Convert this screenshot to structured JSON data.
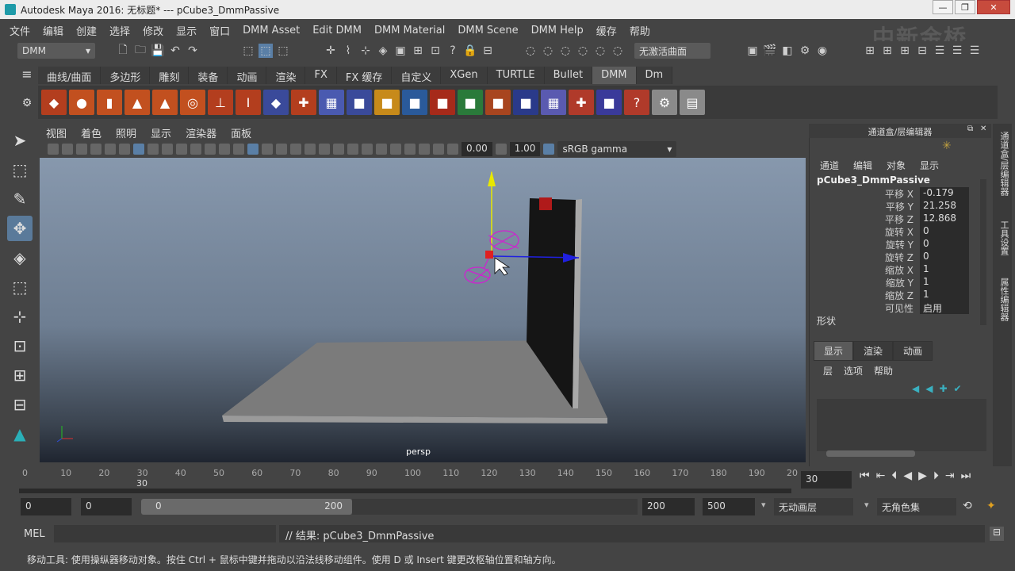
{
  "window": {
    "title": "Autodesk Maya 2016: 无标题*    ---    pCube3_DmmPassive",
    "min": "—",
    "max": "❐",
    "close": "✕"
  },
  "menu": [
    "文件",
    "编辑",
    "创建",
    "选择",
    "修改",
    "显示",
    "窗口",
    "DMM Asset",
    "Edit DMM",
    "DMM Material",
    "DMM Scene",
    "DMM Help",
    "缓存",
    "帮助"
  ],
  "watermark": "中新金桥",
  "status": {
    "mode": "DMM",
    "surface": "无激活曲面"
  },
  "shelf": {
    "tabs": [
      "曲线/曲面",
      "多边形",
      "雕刻",
      "装备",
      "动画",
      "渲染",
      "FX",
      "FX 缓存",
      "自定义",
      "XGen",
      "TURTLE",
      "Bullet",
      "DMM",
      "Dm"
    ],
    "active": "DMM"
  },
  "panel": {
    "menu": [
      "视图",
      "着色",
      "照明",
      "显示",
      "渲染器",
      "面板"
    ],
    "near": "0.00",
    "far": "1.00",
    "colorspace": "sRGB gamma",
    "camera": "persp"
  },
  "timeline": {
    "ticks": [
      "0",
      "10",
      "20",
      "30",
      "40",
      "50",
      "60",
      "70",
      "80",
      "90",
      "100",
      "110",
      "120",
      "130",
      "140",
      "150",
      "160",
      "170",
      "180",
      "190",
      "20"
    ],
    "current": "30",
    "current_marker": "30"
  },
  "range": {
    "start": "0",
    "startin": "0",
    "slider_start": "0",
    "slider_end": "200",
    "end": "200",
    "endall": "500",
    "layer": "无动画层",
    "charset": "无角色集"
  },
  "cmd": {
    "mel": "MEL",
    "result": "// 结果: pCube3_DmmPassive"
  },
  "help": "移动工具: 使用操纵器移动对象。按住 Ctrl + 鼠标中键并拖动以沿法线移动组件。使用 D 或 Insert 键更改枢轴位置和轴方向。",
  "channelbox": {
    "title": "通道盒/层编辑器",
    "menu": [
      "通道",
      "编辑",
      "对象",
      "显示"
    ],
    "object": "pCube3_DmmPassive",
    "attrs": [
      {
        "label": "平移 X",
        "value": "-0.179"
      },
      {
        "label": "平移 Y",
        "value": "21.258"
      },
      {
        "label": "平移 Z",
        "value": "12.868"
      },
      {
        "label": "旋转 X",
        "value": "0"
      },
      {
        "label": "旋转 Y",
        "value": "0"
      },
      {
        "label": "旋转 Z",
        "value": "0"
      },
      {
        "label": "缩放 X",
        "value": "1"
      },
      {
        "label": "缩放 Y",
        "value": "1"
      },
      {
        "label": "缩放 Z",
        "value": "1"
      },
      {
        "label": "可见性",
        "value": "启用"
      }
    ],
    "shape": "形状"
  },
  "layers": {
    "tabs": [
      "显示",
      "渲染",
      "动画"
    ],
    "menu": [
      "层",
      "选项",
      "帮助"
    ]
  },
  "vtabs": [
    "通道盒/层编辑器",
    "工具设置",
    "属性编辑器"
  ]
}
